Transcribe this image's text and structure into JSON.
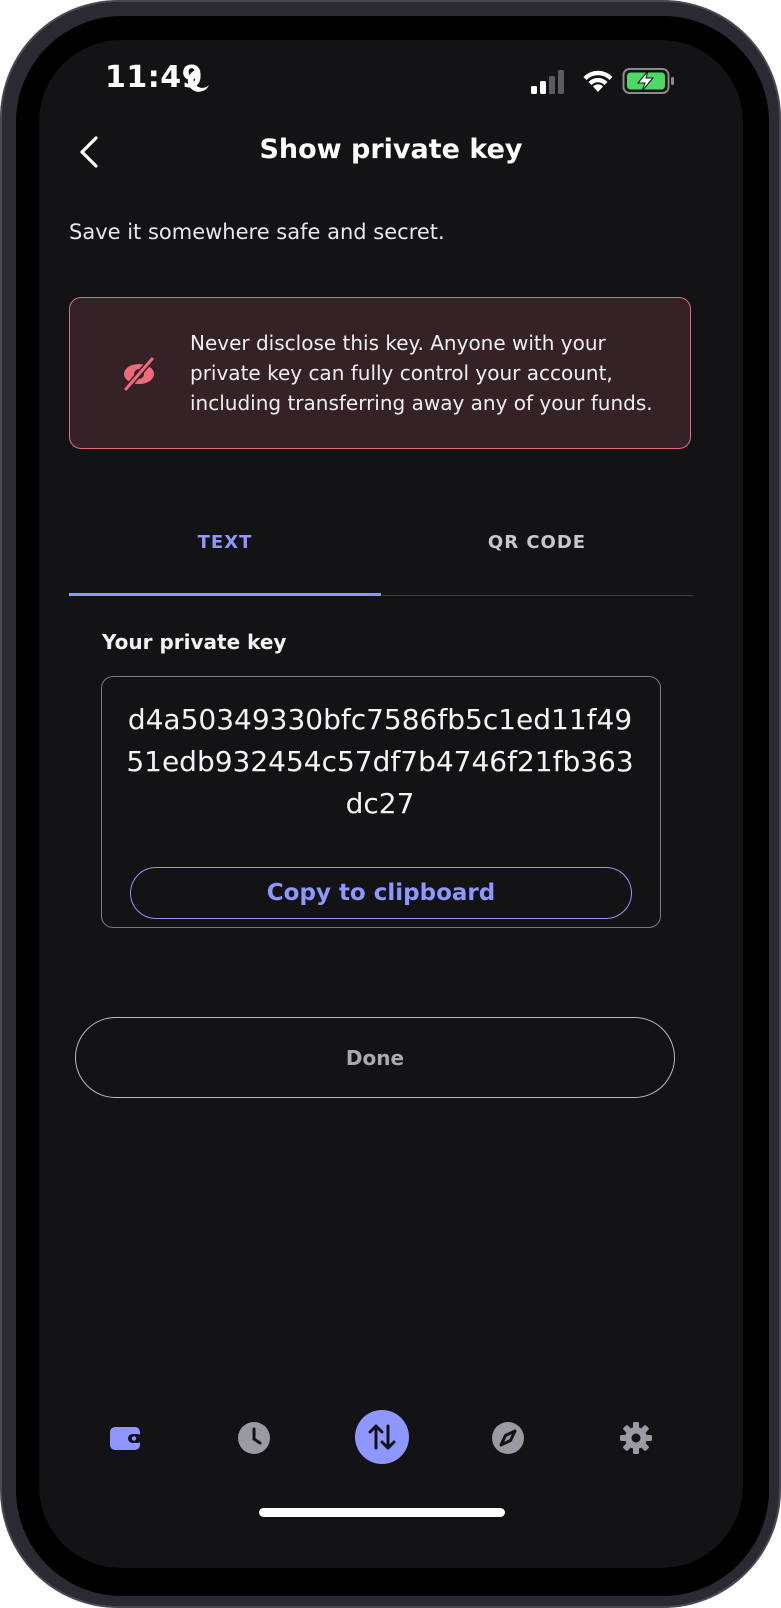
{
  "status_bar": {
    "time": "11:49",
    "icons": [
      "moon-icon",
      "signal-icon",
      "wifi-icon",
      "battery-charging-icon"
    ]
  },
  "header": {
    "title": "Show private key",
    "back_icon": "chevron-left-icon"
  },
  "subtitle": "Save it somewhere safe and secret.",
  "warning": {
    "icon": "eye-off-icon",
    "text": "Never disclose this key. Anyone with your private key can fully control your account, including transferring away any of your funds.",
    "border_color": "#e36a76",
    "background_color": "#352226"
  },
  "tabs": [
    {
      "label": "TEXT",
      "active": true
    },
    {
      "label": "QR CODE",
      "active": false
    }
  ],
  "private_key": {
    "label": "Your private key",
    "value": "d4a50349330bfc7586fb5c1ed11f4951edb932454c57df7b4746f21fb363dc27",
    "copy_label": "Copy to clipboard"
  },
  "done_label": "Done",
  "bottom_nav": [
    {
      "icon": "wallet-icon",
      "active": true
    },
    {
      "icon": "clock-icon",
      "active": false
    },
    {
      "icon": "transfer-arrows-icon",
      "active": false
    },
    {
      "icon": "compass-icon",
      "active": false
    },
    {
      "icon": "gear-icon",
      "active": false
    }
  ],
  "colors": {
    "accent": "#8e96ff",
    "background": "#131315"
  }
}
